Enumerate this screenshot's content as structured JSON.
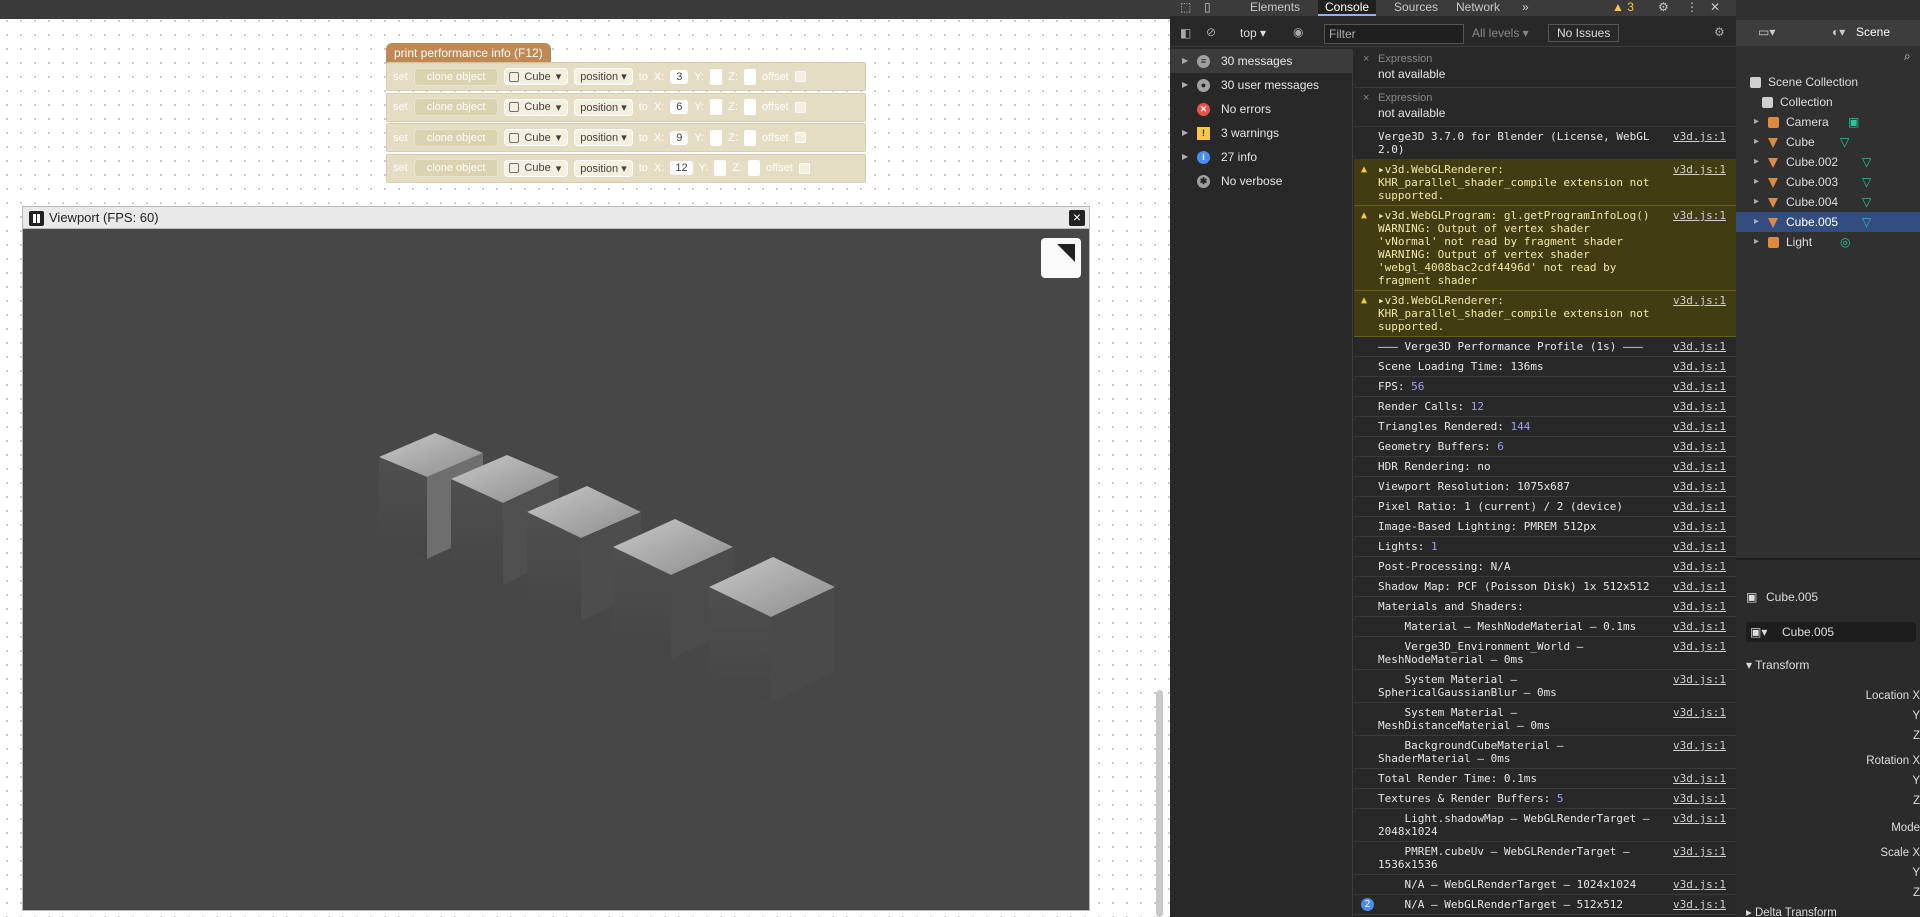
{
  "puzzles": {
    "hat_label": "print performance info (F12)",
    "blocks": [
      {
        "set": "set",
        "clone": "clone object",
        "object": "Cube",
        "prop": "position",
        "to": "to",
        "xl": "X:",
        "x": "3",
        "yl": "Y:",
        "zl": "Z:",
        "offset": "offset"
      },
      {
        "set": "set",
        "clone": "clone object",
        "object": "Cube",
        "prop": "position",
        "to": "to",
        "xl": "X:",
        "x": "6",
        "yl": "Y:",
        "zl": "Z:",
        "offset": "offset"
      },
      {
        "set": "set",
        "clone": "clone object",
        "object": "Cube",
        "prop": "position",
        "to": "to",
        "xl": "X:",
        "x": "9",
        "yl": "Y:",
        "zl": "Z:",
        "offset": "offset"
      },
      {
        "set": "set",
        "clone": "clone object",
        "object": "Cube",
        "prop": "position",
        "to": "to",
        "xl": "X:",
        "x": "12",
        "yl": "Y:",
        "zl": "Z:",
        "offset": "offset"
      }
    ]
  },
  "viewport": {
    "title": "Viewport (FPS: 60)",
    "close": "×"
  },
  "devtools": {
    "tabs": [
      "Elements",
      "Console",
      "Sources",
      "Network"
    ],
    "more": "»",
    "warn_count": "3",
    "context": "top",
    "filter_placeholder": "Filter",
    "levels": "All levels ▾",
    "issues": "No Issues",
    "sidebar": [
      {
        "label": "30 messages",
        "color": "#a0a0a0",
        "icon": "list-icon"
      },
      {
        "label": "30 user messages",
        "color": "#a0a0a0",
        "icon": "user-icon"
      },
      {
        "label": "No errors",
        "color": "#e8524a",
        "icon": "error-icon"
      },
      {
        "label": "3 warnings",
        "color": "#f7c843",
        "icon": "warning-icon"
      },
      {
        "label": "27 info",
        "color": "#4a8df0",
        "icon": "info-icon"
      },
      {
        "label": "No verbose",
        "color": "#a0a0a0",
        "icon": "bug-icon"
      }
    ],
    "expressions": [
      {
        "label": "Expression",
        "value": "not available"
      },
      {
        "label": "Expression",
        "value": "not available"
      }
    ],
    "source": "v3d.js:1",
    "rows": [
      {
        "type": "log",
        "text": "Verge3D 3.7.0 for Blender (License, WebGL 2.0)"
      },
      {
        "type": "warn",
        "text": "▸v3d.WebGLRenderer: KHR_parallel_shader_compile extension not supported."
      },
      {
        "type": "warn",
        "text": "▸v3d.WebGLProgram: gl.getProgramInfoLog() WARNING: Output of vertex shader 'vNormal' not read by fragment shader WARNING: Output of vertex shader 'webgl_4008bac2cdf4496d' not read by fragment shader"
      },
      {
        "type": "warn",
        "text": "▸v3d.WebGLRenderer: KHR_parallel_shader_compile extension not supported."
      },
      {
        "type": "log",
        "text": "——— Verge3D Performance Profile (1s) ———"
      },
      {
        "type": "log",
        "text": "Scene Loading Time: 136ms"
      },
      {
        "type": "log",
        "text": "FPS: ",
        "num": "56"
      },
      {
        "type": "log",
        "text": "Render Calls: ",
        "num": "12"
      },
      {
        "type": "log",
        "text": "Triangles Rendered: ",
        "num": "144"
      },
      {
        "type": "log",
        "text": "Geometry Buffers: ",
        "num": "6"
      },
      {
        "type": "log",
        "text": "HDR Rendering: no"
      },
      {
        "type": "log",
        "text": "Viewport Resolution: 1075x687"
      },
      {
        "type": "log",
        "text": "Pixel Ratio: 1 (current) / 2 (device)"
      },
      {
        "type": "log",
        "text": "Image-Based Lighting: PMREM 512px"
      },
      {
        "type": "log",
        "text": "Lights: ",
        "num": "1"
      },
      {
        "type": "log",
        "text": "Post-Processing: N/A"
      },
      {
        "type": "log",
        "text": "Shadow Map: PCF (Poisson Disk) 1x 512x512"
      },
      {
        "type": "log",
        "text": "Materials and Shaders:"
      },
      {
        "type": "log",
        "text": "    Material – MeshNodeMaterial – 0.1ms"
      },
      {
        "type": "log",
        "text": "    Verge3D_Environment_World – MeshNodeMaterial – 0ms"
      },
      {
        "type": "log",
        "text": "    System Material – SphericalGaussianBlur – 0ms"
      },
      {
        "type": "log",
        "text": "    System Material – MeshDistanceMaterial – 0ms"
      },
      {
        "type": "log",
        "text": "    BackgroundCubeMaterial – ShaderMaterial – 0ms"
      },
      {
        "type": "log",
        "text": "Total Render Time: 0.1ms"
      },
      {
        "type": "log",
        "text": "Textures & Render Buffers: ",
        "num": "5"
      },
      {
        "type": "log",
        "text": "    Light.shadowMap – WebGLRenderTarget – 2048x1024"
      },
      {
        "type": "log",
        "text": "    PMREM.cubeUv – WebGLRenderTarget – 1536x1536"
      },
      {
        "type": "log",
        "text": "    N/A – WebGLRenderTarget – 1024x1024"
      },
      {
        "type": "log",
        "text": "    N/A – WebGLRenderTarget – 512x512",
        "badge": "2"
      }
    ],
    "prompt": "›"
  },
  "blender": {
    "scene_label": "Scene",
    "tree": [
      {
        "label": "Scene Collection",
        "kind": "collection"
      },
      {
        "label": "Collection",
        "kind": "collection"
      },
      {
        "label": "Camera",
        "kind": "camera"
      },
      {
        "label": "Cube",
        "kind": "mesh"
      },
      {
        "label": "Cube.002",
        "kind": "mesh"
      },
      {
        "label": "Cube.003",
        "kind": "mesh"
      },
      {
        "label": "Cube.004",
        "kind": "mesh"
      },
      {
        "label": "Cube.005",
        "kind": "mesh",
        "selected": true
      },
      {
        "label": "Light",
        "kind": "light"
      }
    ],
    "props": {
      "object_name": "Cube.005",
      "field_name": "Cube.005",
      "panel": "Transform",
      "labels": [
        "Location X",
        "Y",
        "Z",
        "Rotation X",
        "Y",
        "Z",
        "Mode",
        "Scale X",
        "Y",
        "Z"
      ],
      "delta": "Delta Transform"
    },
    "colors": {
      "selected": "#334d80",
      "mesh": "#e0893a",
      "accent": "#27c9a0"
    }
  }
}
